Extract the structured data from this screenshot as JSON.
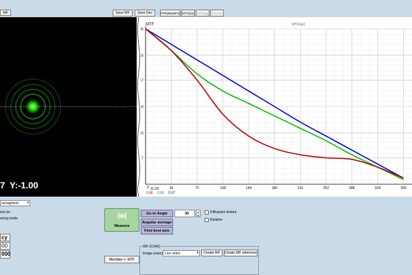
{
  "top": {
    "wf_label": "WF",
    "save_wf": "Save WF",
    "save_dev": "Save Dev",
    "tabs": [
      "TFR(tiltaMFO)",
      "MTF(tar)",
      "MTF(sag)",
      "MTF(min)"
    ]
  },
  "psf": {
    "y_readout": "Y:-1.00",
    "x_partial": "7",
    "colors": {
      "spot": "#39ff14",
      "background": "#000000"
    }
  },
  "chart_data": {
    "type": "line",
    "title": "MTF(tar)",
    "y_axis_label": "MTF",
    "x": [
      0,
      36,
      72,
      108,
      144,
      180,
      216,
      252,
      288,
      324,
      360
    ],
    "xlim": [
      0,
      372
    ],
    "ylim": [
      0,
      1.0
    ],
    "yticks": [
      "1.00",
      "0.83",
      "0.67",
      "0.50",
      "0.33",
      "0.17",
      "0"
    ],
    "xticks": [
      "0",
      "36",
      "72",
      "108",
      "144",
      "180",
      "216",
      "252",
      "288",
      "324",
      "360"
    ],
    "x_prefix": "11.03",
    "cursor_values": [
      {
        "value": "0.96",
        "color": "#c00000"
      },
      {
        "value": "0.96",
        "color": "#00aa00"
      },
      {
        "value": "0.97",
        "color": "#0000cc"
      }
    ],
    "series": [
      {
        "color": "#0000dd",
        "values": [
          1.0,
          0.9,
          0.8,
          0.7,
          0.6,
          0.5,
          0.4,
          0.31,
          0.22,
          0.13,
          0.04
        ]
      },
      {
        "color": "#00bb00",
        "values": [
          1.0,
          0.86,
          0.71,
          0.6,
          0.52,
          0.44,
          0.36,
          0.28,
          0.19,
          0.11,
          0.03
        ]
      },
      {
        "color": "#bb0000",
        "values": [
          1.0,
          0.86,
          0.67,
          0.45,
          0.31,
          0.23,
          0.19,
          0.17,
          0.16,
          0.11,
          0.04
        ]
      }
    ],
    "grid": true
  },
  "controls": {
    "dropdown_value": "on/aspheric",
    "text_partial_1": "ent ion",
    "text_partial_2": "acing mode",
    "table_header": "cy",
    "table_val_1": "00",
    "table_val_2": "000",
    "measure_label": "Measure",
    "go_to_angle": "Go to Angle",
    "angle_value": "30",
    "angular_average": "Angular average",
    "find_best_axis": "Find best axis",
    "diffraction_limited": "Diffraction limited",
    "relative": "Relative",
    "meridian_btn": "Meridian <- MTF"
  },
  "wf_group": {
    "title": "WF (0.540)",
    "image_source_label": "Image source",
    "image_source_value": "Live video",
    "create_wf": "Create WF",
    "create_wf_reference": "Create WF reference"
  }
}
